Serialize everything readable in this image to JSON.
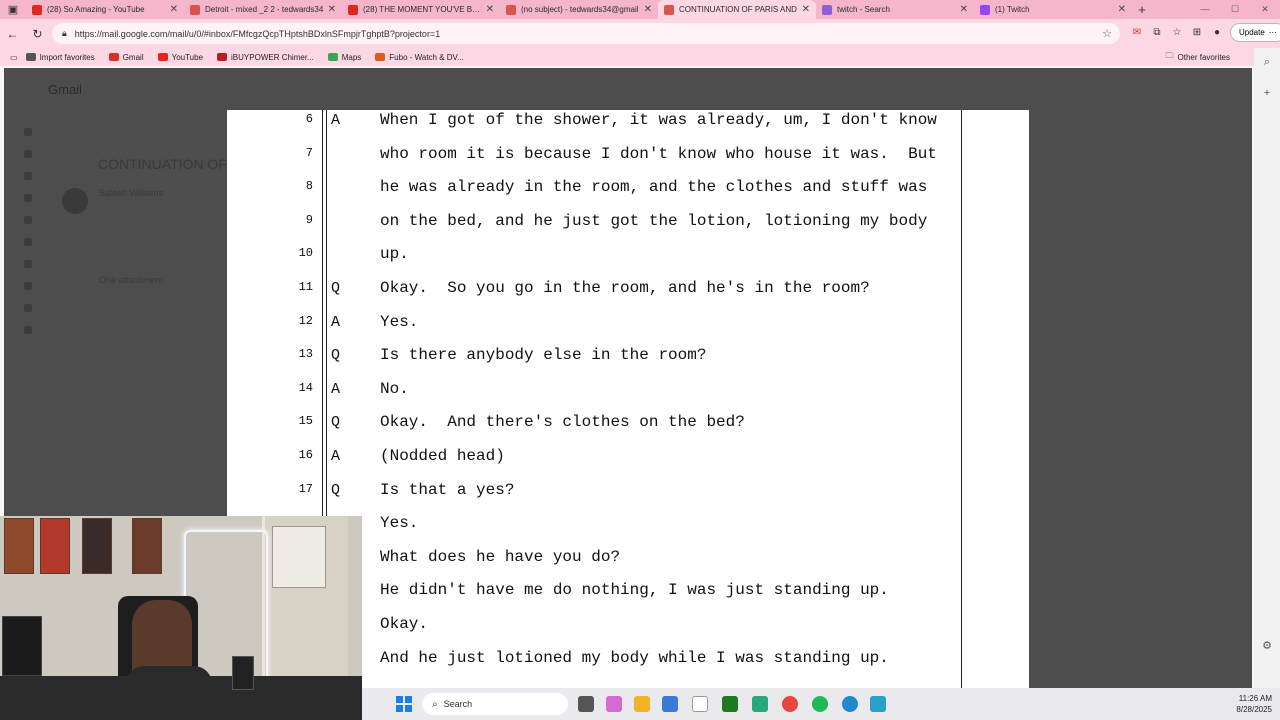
{
  "tabs": [
    {
      "title": "(28) So Amazing - YouTube",
      "color": "#e0281f"
    },
    {
      "title": "Detroit - mixed _2 2 - tedwards34",
      "color": "#d9534f"
    },
    {
      "title": "(28) THE MOMENT YOU'VE BEEN",
      "color": "#e0281f"
    },
    {
      "title": "(no subject) - tedwards34@gmail",
      "color": "#d9534f"
    },
    {
      "title": "CONTINUATION OF PARIS AND",
      "color": "#d9534f"
    },
    {
      "title": "twitch - Search",
      "color": "#8e5fd6"
    },
    {
      "title": "(1) Twitch",
      "color": "#9146ff"
    }
  ],
  "url": "https://mail.google.com/mail/u/0/#inbox/FMfcgzQcpTHptshBDxlnSFmpjrTghptB?projector=1",
  "update_label": "Update",
  "bookmarks": [
    {
      "label": "Import favorites",
      "color": "#555555"
    },
    {
      "label": "Gmail",
      "color": "#d93025"
    },
    {
      "label": "YouTube",
      "color": "#e0281f"
    },
    {
      "label": "iBUYPOWER Chimer...",
      "color": "#b32020"
    },
    {
      "label": "Maps",
      "color": "#34a853"
    },
    {
      "label": "Fubo - Watch & DV...",
      "color": "#e05a1a"
    }
  ],
  "other_favorites": "Other favorites",
  "gmail": {
    "logo": "Gmail",
    "subject": "CONTINUATION OF",
    "sender": "Saleah Williams",
    "attachment": "One attachment"
  },
  "transcript": [
    {
      "line": "6",
      "speaker": "A",
      "text": "When I got of the shower, it was already, um, I don't know"
    },
    {
      "line": "7",
      "speaker": "",
      "text": "who room it is because I don't know who house it was.  But"
    },
    {
      "line": "8",
      "speaker": "",
      "text": "he was already in the room, and the clothes and stuff was"
    },
    {
      "line": "9",
      "speaker": "",
      "text": "on the bed, and he just got the lotion, lotioning my body"
    },
    {
      "line": "10",
      "speaker": "",
      "text": "up."
    },
    {
      "line": "11",
      "speaker": "Q",
      "text": "Okay.  So you go in the room, and he's in the room?"
    },
    {
      "line": "12",
      "speaker": "A",
      "text": "Yes."
    },
    {
      "line": "13",
      "speaker": "Q",
      "text": "Is there anybody else in the room?"
    },
    {
      "line": "14",
      "speaker": "A",
      "text": "No."
    },
    {
      "line": "15",
      "speaker": "Q",
      "text": "Okay.  And there's clothes on the bed?"
    },
    {
      "line": "16",
      "speaker": "A",
      "text": "(Nodded head)"
    },
    {
      "line": "17",
      "speaker": "Q",
      "text": "Is that a yes?"
    },
    {
      "line": "",
      "speaker": "",
      "text": "Yes."
    },
    {
      "line": "",
      "speaker": "",
      "text": "What does he have you do?"
    },
    {
      "line": "",
      "speaker": "",
      "text": "He didn't have me do nothing, I was just standing up."
    },
    {
      "line": "",
      "speaker": "",
      "text": "Okay."
    },
    {
      "line": "",
      "speaker": "",
      "text": "And he just lotioned my body while I was standing up."
    }
  ],
  "taskbar": {
    "search_label": "Search",
    "time": "11:26 AM",
    "date": "8/28/2025"
  }
}
